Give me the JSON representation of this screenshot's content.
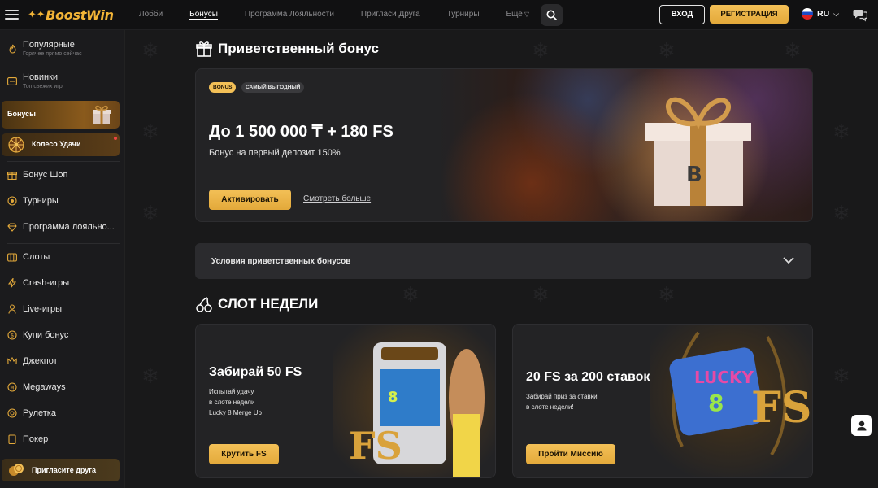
{
  "header": {
    "logo_text": "BoostWin",
    "nav": [
      {
        "label": "Лобби"
      },
      {
        "label": "Бонусы"
      },
      {
        "label": "Программа Лояльности"
      },
      {
        "label": "Пригласи Друга"
      },
      {
        "label": "Турниры"
      },
      {
        "label": "Еще"
      }
    ],
    "login_label": "ВХОД",
    "register_label": "РЕГИСТРАЦИЯ",
    "lang": "RU"
  },
  "sidebar": {
    "top": [
      {
        "label": "Популярные",
        "sub": "Горячее прямо сейчас",
        "icon": "flame-icon"
      },
      {
        "label": "Новинки",
        "sub": "Топ свежих игр",
        "icon": "new-games-icon"
      }
    ],
    "bonus_label": "Бонусы",
    "wheel_label": "Колесо Удачи",
    "mid": [
      {
        "label": "Бонус Шоп",
        "icon": "gift-icon"
      },
      {
        "label": "Турниры",
        "icon": "tournament-icon"
      },
      {
        "label": "Программа лояльно...",
        "icon": "diamond-icon"
      }
    ],
    "games": [
      {
        "label": "Слоты",
        "icon": "slots-icon"
      },
      {
        "label": "Crash-игры",
        "icon": "lightning-icon"
      },
      {
        "label": "Live-игры",
        "icon": "live-icon"
      },
      {
        "label": "Купи бонус",
        "icon": "coin-icon"
      },
      {
        "label": "Джекпот",
        "icon": "crown-icon"
      },
      {
        "label": "Megaways",
        "icon": "megaways-icon"
      },
      {
        "label": "Рулетка",
        "icon": "roulette-icon"
      },
      {
        "label": "Покер",
        "icon": "cards-icon"
      }
    ],
    "invite_label": "Пригласите друга"
  },
  "welcome": {
    "title": "Приветственный бонус",
    "badge_1": "BONUS",
    "badge_2": "САМЫЙ ВЫГОДНЫЙ",
    "headline": "До 1 500 000 ₸ + 180 FS",
    "subline": "Бонус на первый депозит 150%",
    "activate_label": "Активировать",
    "more_label": "Смотреть больше",
    "conditions_label": "Условия приветственных бонусов"
  },
  "slot_week": {
    "title": "СЛОТ НЕДЕЛИ",
    "cards": [
      {
        "title": "Забирай 50 FS",
        "desc": [
          "Испытай удачу",
          "в слоте недели",
          "Lucky 8 Merge Up"
        ],
        "button": "Крутить FS"
      },
      {
        "title": "20 FS за 200 ставок",
        "desc": [
          "Забирай приз за ставки",
          "в слоте недели!"
        ],
        "button": "Пройти Миссию"
      }
    ]
  },
  "colors": {
    "accent": "#f3c057",
    "background": "#19191a",
    "sidebar": "#1b1b1d"
  }
}
